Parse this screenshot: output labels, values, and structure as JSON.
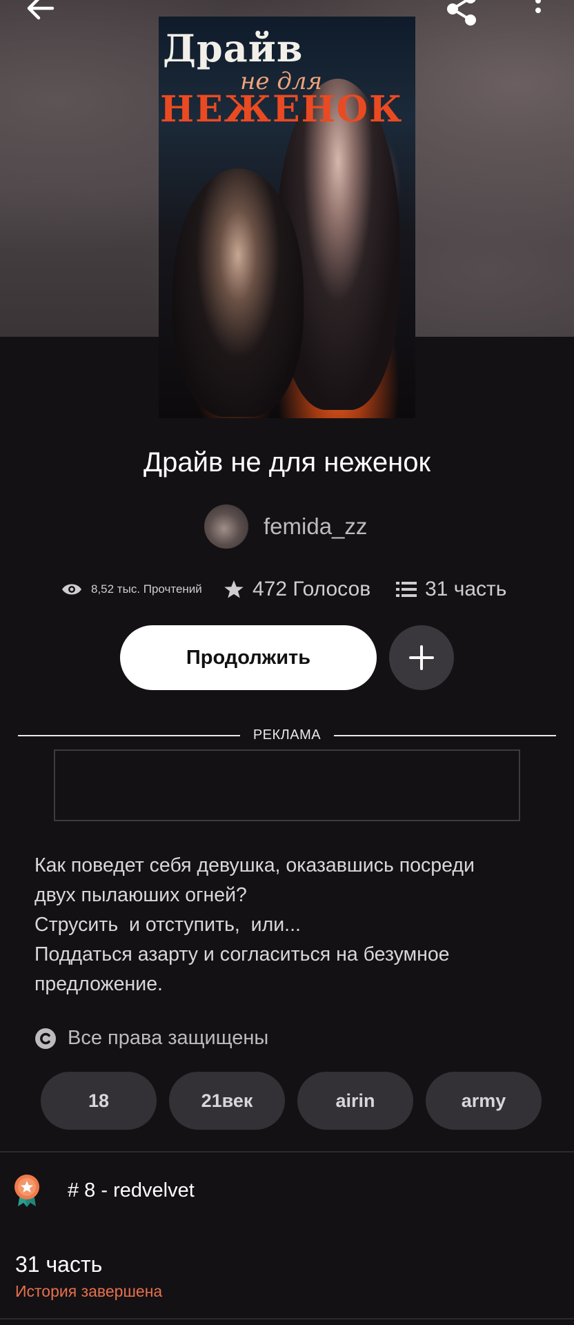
{
  "header": {
    "back_icon": "arrow-left-icon",
    "share_icon": "share-icon",
    "more_icon": "more-vertical-icon"
  },
  "cover": {
    "title_line1": "Драйв",
    "title_line2": "не для",
    "title_line3": "НЕЖЕНОК"
  },
  "story": {
    "title": "Драйв не для неженок",
    "author": "femida_zz"
  },
  "stats": {
    "reads": "8,52 тыс. Прочтений",
    "votes": "472 Голосов",
    "parts": "31 часть"
  },
  "actions": {
    "continue_label": "Продолжить",
    "add_icon": "plus-icon"
  },
  "ad": {
    "label": "РЕКЛАМА"
  },
  "description": {
    "lines": [
      "Как поведет себя девушка, оказавшись посреди",
      "двух пылаюших огней?",
      "Струсить  и отступить,  или...",
      "Поддаться азарту и согласиться на безумное",
      "предложение."
    ]
  },
  "rights": {
    "icon": "copyright-icon",
    "text": "Все права защищены"
  },
  "tags": [
    "18",
    "21век",
    "airin",
    "army"
  ],
  "rank": {
    "icon": "ranking-badge-icon",
    "text": "# 8 - redvelvet"
  },
  "parts_section": {
    "title": "31 часть",
    "status": "История завершена"
  },
  "colors": {
    "background": "#131114",
    "accent_status": "#e8704d",
    "tag_bg": "#333135"
  }
}
